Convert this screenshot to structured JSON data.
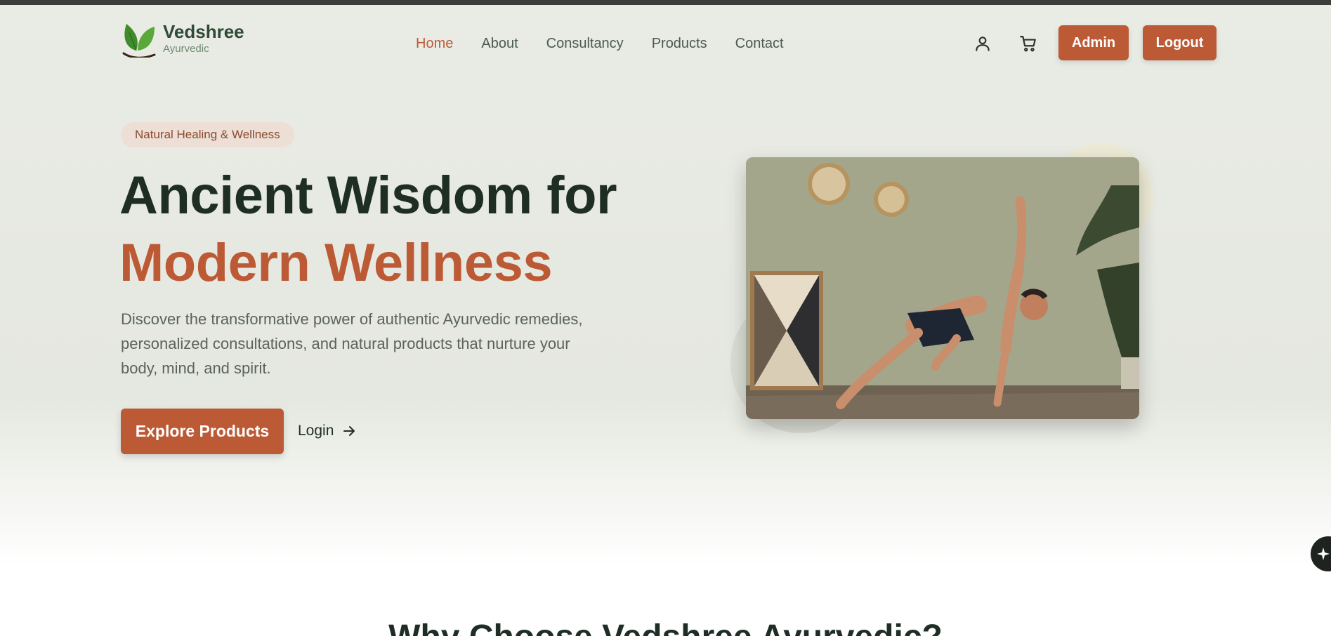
{
  "brand": {
    "name": "Vedshree",
    "tagline": "Ayurvedic"
  },
  "nav": {
    "items": [
      {
        "label": "Home",
        "active": true
      },
      {
        "label": "About",
        "active": false
      },
      {
        "label": "Consultancy",
        "active": false
      },
      {
        "label": "Products",
        "active": false
      },
      {
        "label": "Contact",
        "active": false
      }
    ]
  },
  "header_actions": {
    "account_icon": "user-icon",
    "cart_icon": "cart-icon",
    "admin_label": "Admin",
    "logout_label": "Logout"
  },
  "hero": {
    "badge": "Natural Healing & Wellness",
    "title_line1": "Ancient Wisdom for",
    "title_line2": "Modern Wellness",
    "description": "Discover the transformative power of authentic Ayurvedic remedies, personalized consultations, and natural products that nurture your body, mind, and spirit.",
    "primary_cta": "Explore Products",
    "secondary_cta": "Login"
  },
  "next_section": {
    "title": "Why Choose Vedshree Ayurvedic?"
  },
  "colors": {
    "accent": "#bc5a35",
    "dark_green": "#1f2e25",
    "brand_green": "#2f4a35",
    "hero_bg": "#e7eae2",
    "badge_bg": "#eddfd6"
  }
}
